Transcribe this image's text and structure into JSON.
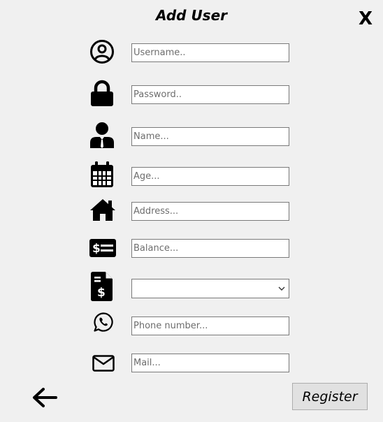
{
  "window": {
    "title": "Add User",
    "close_label": "X"
  },
  "form": {
    "username": {
      "placeholder": "Username..",
      "value": ""
    },
    "password": {
      "placeholder": "Password..",
      "value": ""
    },
    "name": {
      "placeholder": "Name...",
      "value": ""
    },
    "age": {
      "placeholder": "Age...",
      "value": ""
    },
    "address": {
      "placeholder": "Address...",
      "value": ""
    },
    "balance": {
      "placeholder": "Balance...",
      "value": ""
    },
    "account_type": {
      "selected": ""
    },
    "phone": {
      "placeholder": "Phone number...",
      "value": ""
    },
    "mail": {
      "placeholder": "Mail...",
      "value": ""
    }
  },
  "actions": {
    "register_label": "Register"
  },
  "icons": {
    "username": "user-circle-icon",
    "password": "lock-icon",
    "name": "person-tie-icon",
    "age": "calendar-icon",
    "address": "home-icon",
    "balance": "money-bill-icon",
    "account_type": "invoice-dollar-icon",
    "phone": "whatsapp-icon",
    "mail": "envelope-icon",
    "back": "arrow-left-icon"
  },
  "colors": {
    "background": "#f0f0f0",
    "field_border": "#7a7a7a",
    "button_face": "#e1e1e1",
    "icon": "#000000"
  }
}
